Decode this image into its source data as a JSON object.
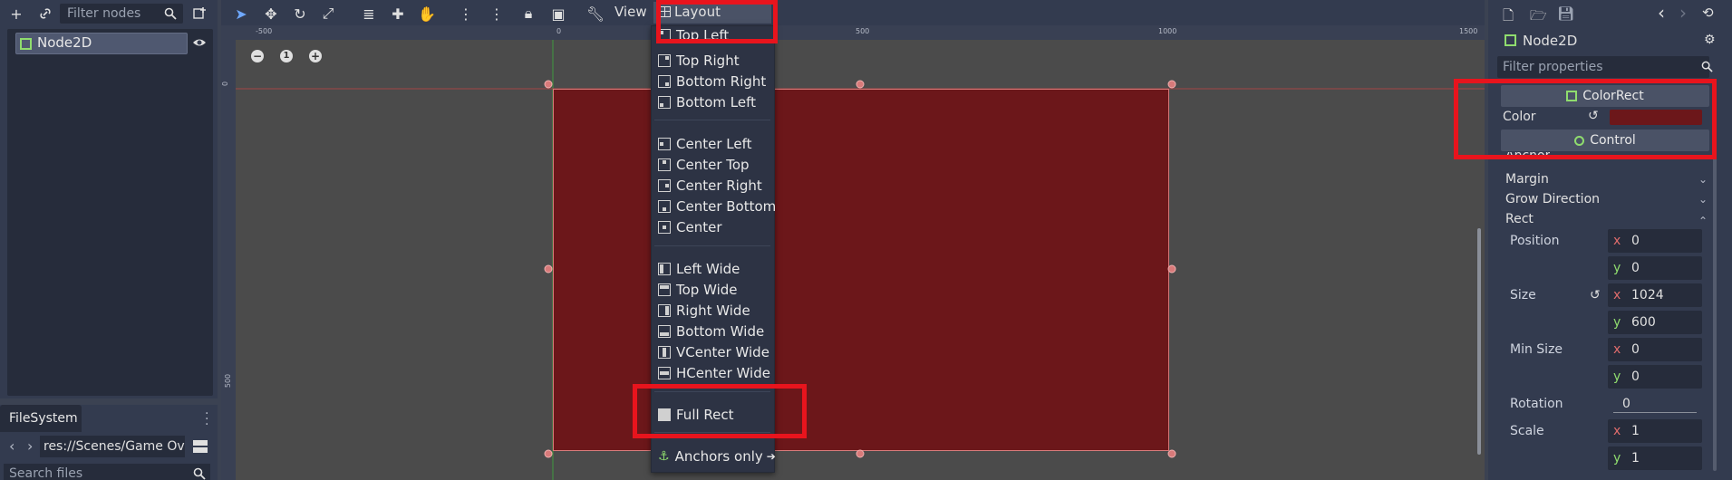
{
  "scene_dock": {
    "filter_placeholder": "Filter nodes",
    "tree": [
      {
        "label": "Node2D"
      }
    ]
  },
  "filesystem": {
    "tab_label": "FileSystem",
    "path": "res://Scenes/Game Ov",
    "search_placeholder": "Search files"
  },
  "toolbar": {
    "view_label": "View",
    "layout_label": "Layout"
  },
  "rulers": {
    "top": [
      "-500",
      "0",
      "500",
      "1000",
      "1500"
    ],
    "left": [
      "0",
      "500"
    ]
  },
  "zoom": {
    "reset_label": "1"
  },
  "layout_menu": {
    "partial_item": "Top Left",
    "items": [
      "Top Right",
      "Bottom Right",
      "Bottom Left",
      "Center Left",
      "Center Top",
      "Center Right",
      "Center Bottom",
      "Center",
      "Left Wide",
      "Top Wide",
      "Right Wide",
      "Bottom Wide",
      "VCenter Wide",
      "HCenter Wide",
      "Full Rect",
      "Anchors only"
    ]
  },
  "inspector": {
    "node_name": "Node2D",
    "filter_placeholder": "Filter properties",
    "section_colorrect": "ColorRect",
    "color_label": "Color",
    "color_value": "#6c171a",
    "section_control": "Control",
    "groups": {
      "anchor": "Anchor",
      "margin": "Margin",
      "grow": "Grow Direction",
      "rect": "Rect"
    },
    "props": {
      "position_label": "Position",
      "position_x": "0",
      "position_y": "0",
      "size_label": "Size",
      "size_x": "1024",
      "size_y": "600",
      "minsize_label": "Min Size",
      "minsize_x": "0",
      "minsize_y": "0",
      "rotation_label": "Rotation",
      "rotation_value": "0",
      "scale_label": "Scale",
      "scale_x": "1",
      "scale_y": "1",
      "axis_x": "x",
      "axis_y": "y"
    }
  },
  "colors": {
    "highlight": "#e8141d",
    "rect_fill": "#6c171a",
    "accent_green": "#8fdc6e"
  }
}
